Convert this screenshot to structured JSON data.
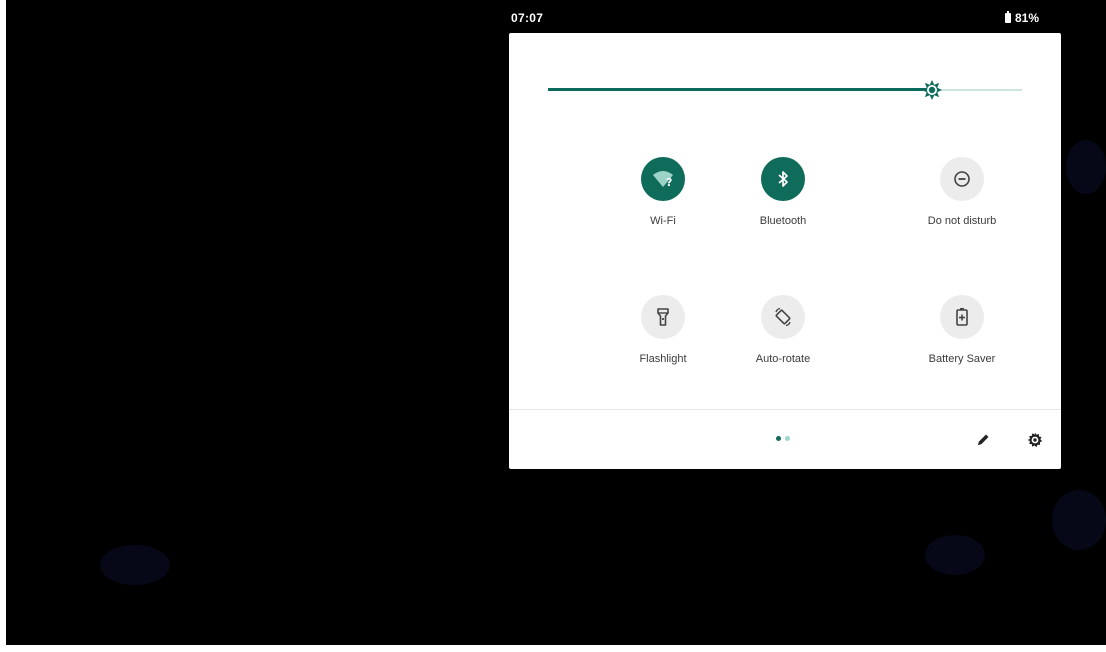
{
  "status_bar": {
    "time": "07:07",
    "battery_percent": "81%"
  },
  "brightness": {
    "level": 0.81
  },
  "quick_tiles": [
    {
      "label": "Wi-Fi",
      "icon": "wifi-question-icon",
      "state": "on"
    },
    {
      "label": "Bluetooth",
      "icon": "bluetooth-icon",
      "state": "on"
    },
    {
      "label": "Do not disturb",
      "icon": "do-not-disturb-icon",
      "state": "off"
    },
    {
      "label": "Flashlight",
      "icon": "flashlight-icon",
      "state": "off"
    },
    {
      "label": "Auto-rotate",
      "icon": "auto-rotate-icon",
      "state": "off"
    },
    {
      "label": "Battery Saver",
      "icon": "battery-saver-icon",
      "state": "off"
    }
  ],
  "pagination": {
    "current_page": 1,
    "total_pages": 2
  },
  "footer": {
    "edit_icon": "pencil-icon",
    "settings_icon": "gear-icon"
  },
  "colors": {
    "accent": "#0f6b5a",
    "tile_off": "#ececec",
    "dot_active": "#0f6b5a",
    "dot_inactive": "#9fd6cb"
  }
}
